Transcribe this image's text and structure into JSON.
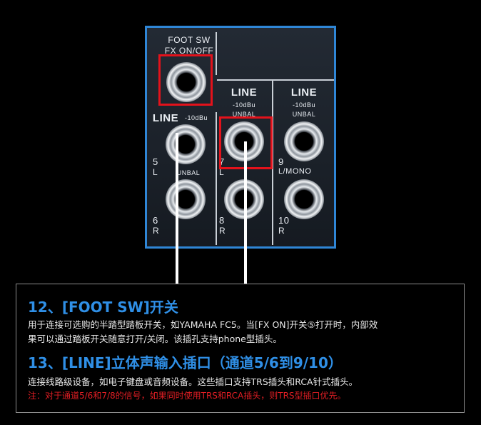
{
  "panel": {
    "foot_sw": "FOOT SW",
    "fx_on_off": "FX ON/OFF",
    "line_left": "LINE",
    "line_mid": "LINE",
    "line_right": "LINE",
    "level_left": "-10dBu",
    "level_mid": "-10dBu",
    "level_right": "-10dBu",
    "unbal_mid": "UNBAL",
    "unbal_right": "UNBAL",
    "unbal_left": "UNBAL",
    "ch5": "5",
    "ch5_side": "L",
    "ch6": "6",
    "ch6_side": "R",
    "ch7": "7",
    "ch7_side": "L",
    "ch8": "8",
    "ch8_side": "R",
    "ch9": "9",
    "ch9_side": "L/MONO",
    "ch10": "10",
    "ch10_side": "R"
  },
  "section12": {
    "title": "12、[FOOT SW]开关",
    "line1": "用于连接可选购的半踏型踏板开关，如YAMAHA FC5。当[FX ON]开关⑤打开时，内部效",
    "line2": "果可以通过踏板开关随意打开/关闭。该插孔支持phone型插头。"
  },
  "section13": {
    "title": "13、[LINE]立体声输入插口（通道5/6到9/10）",
    "line1": "连接线路级设备，如电子键盘或音频设备。这些插口支持TRS插头和RCA针式插头。",
    "note": "注：对于通道5/6和7/8的信号，如果同时使用TRS和RCA插头，则TRS型插口优先。"
  },
  "colors": {
    "accent_blue": "#2f86d6",
    "highlight_red": "#e3121b",
    "note_red": "#e31e24"
  }
}
